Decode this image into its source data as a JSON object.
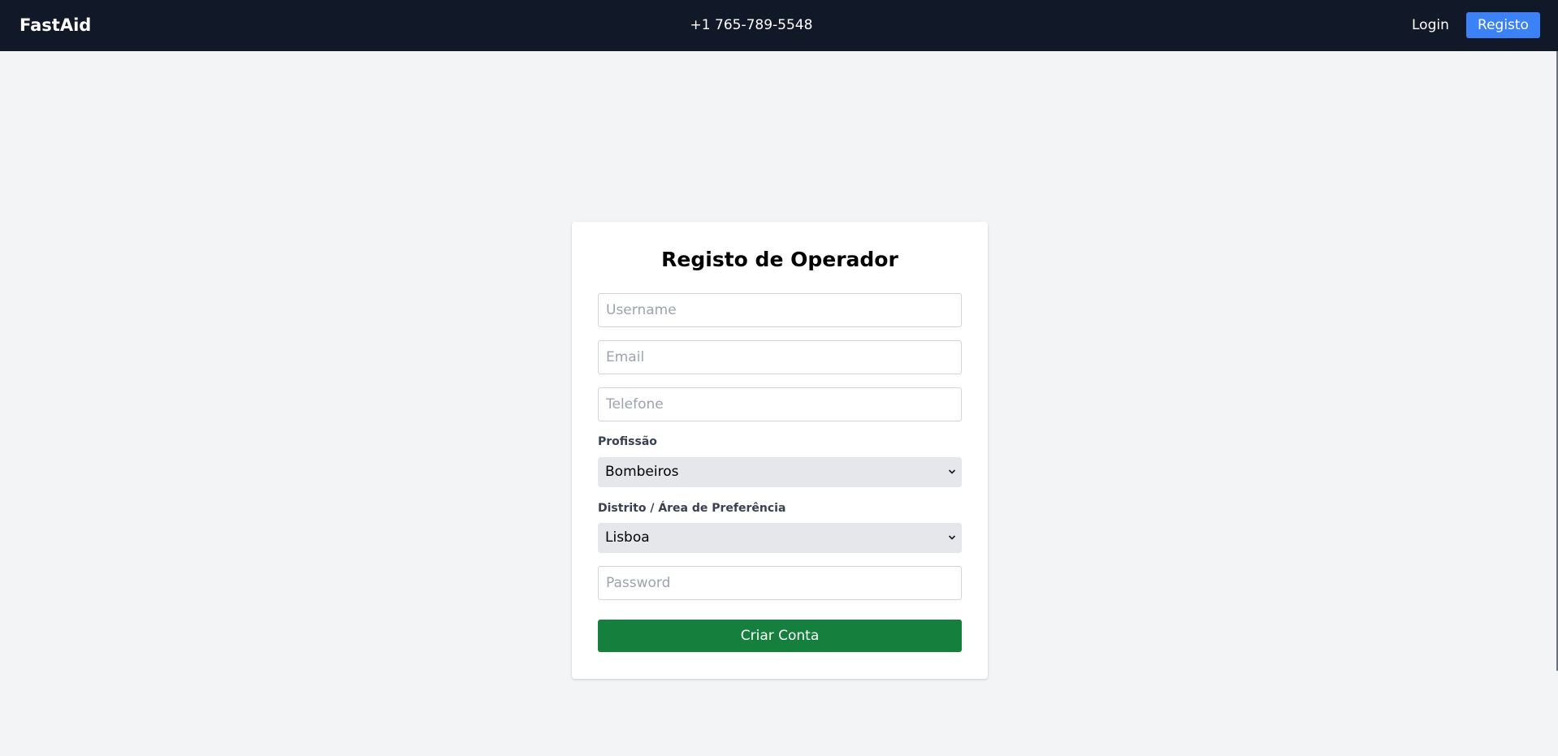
{
  "header": {
    "brand": "FastAid",
    "phone": "+1 765-789-5548",
    "login_label": "Login",
    "register_label": "Registo"
  },
  "form": {
    "title": "Registo de Operador",
    "username_placeholder": "Username",
    "email_placeholder": "Email",
    "phone_placeholder": "Telefone",
    "profession_label": "Profissão",
    "profession_value": "Bombeiros",
    "district_label": "Distrito / Área de Preferência",
    "district_value": "Lisboa",
    "password_placeholder": "Password",
    "submit_label": "Criar Conta"
  },
  "colors": {
    "header_bg": "#111827",
    "register_button": "#3b82f6",
    "submit_button": "#15803d",
    "page_bg": "#f3f4f6"
  }
}
